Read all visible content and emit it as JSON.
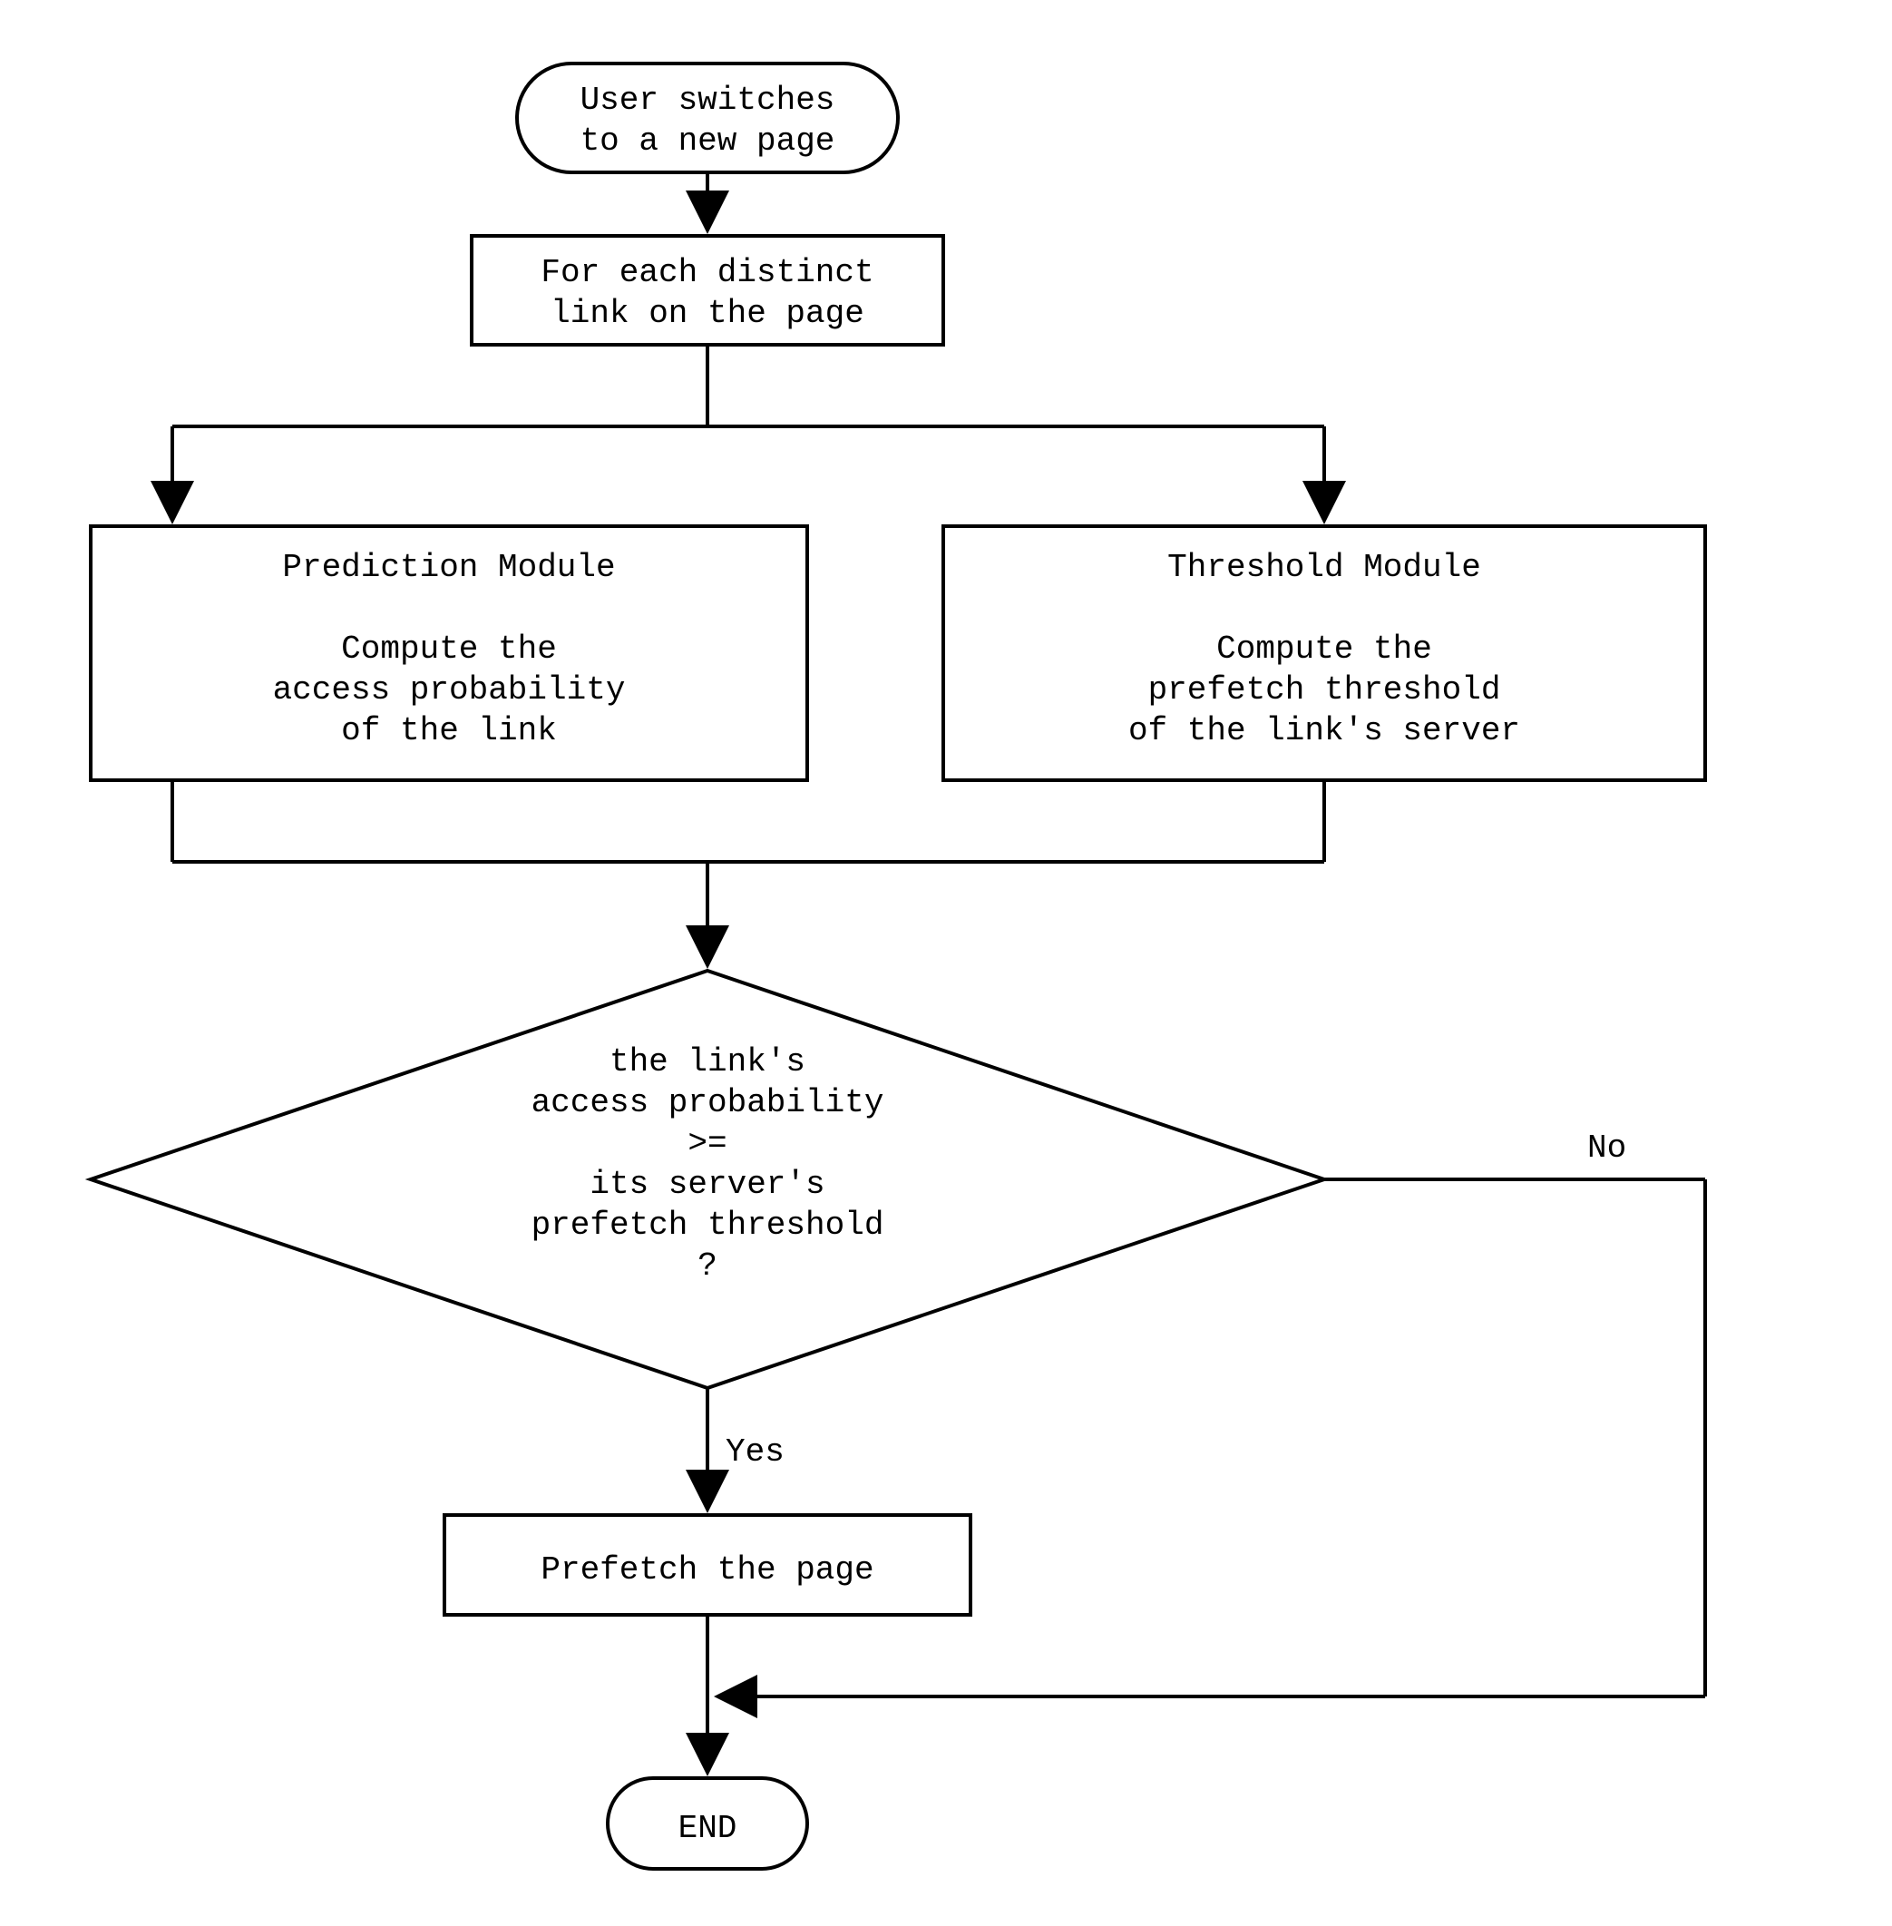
{
  "flowchart": {
    "nodes": {
      "start": {
        "line1": "User switches",
        "line2": "to a new page"
      },
      "foreach": {
        "line1": "For each distinct",
        "line2": "link on the page"
      },
      "prediction": {
        "title": "Prediction Module",
        "line1": "Compute the",
        "line2": "access probability",
        "line3": "of the link"
      },
      "threshold": {
        "title": "Threshold Module",
        "line1": "Compute the",
        "line2": "prefetch threshold",
        "line3": "of the link's server"
      },
      "decision": {
        "line1": "the link's",
        "line2": "access probability",
        "line3": ">=",
        "line4": "its server's",
        "line5": "prefetch threshold",
        "line6": "?"
      },
      "prefetch": {
        "text": "Prefetch the page"
      },
      "end": {
        "text": "END"
      }
    },
    "labels": {
      "yes": "Yes",
      "no": "No"
    }
  }
}
